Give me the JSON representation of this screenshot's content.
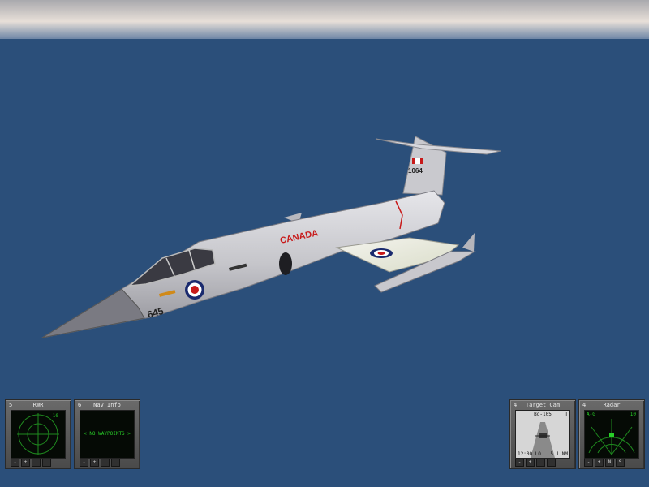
{
  "colors": {
    "sky_top": "#b8b8b8",
    "sky_horizon": "#f0e6dc",
    "ocean": "#2b4f7a",
    "aircraft": "#c8c8cc",
    "roundel_red": "#c81a1a",
    "roundel_blue": "#1a2a6e",
    "mfd_green": "#28d028"
  },
  "aircraft": {
    "fuselage_text": "CANADA",
    "tail_number": "645",
    "fin_text": "1064",
    "roundel_icon": "rcaf-roundel"
  },
  "mfds": [
    {
      "id": "rwr",
      "number": "5",
      "title": "RWR",
      "readout": "10",
      "buttons": [
        "-",
        "+",
        "",
        ""
      ]
    },
    {
      "id": "nav-info",
      "number": "6",
      "title": "Nav Info",
      "message": "< NO WAYPOINTS >",
      "buttons": [
        "-",
        "+",
        "",
        ""
      ]
    },
    {
      "id": "target-cam",
      "number": "4",
      "title": "Target Cam",
      "target": "Bo-105",
      "marker": "T",
      "readout_left": "12:00 LO",
      "readout_right": "5.1 NM",
      "buttons": [
        "-",
        "+",
        "",
        ""
      ]
    },
    {
      "id": "radar",
      "number": "4",
      "title": "Radar",
      "mode": "A-G",
      "range": "10",
      "buttons": [
        "-",
        "+",
        "N",
        "S"
      ]
    }
  ]
}
